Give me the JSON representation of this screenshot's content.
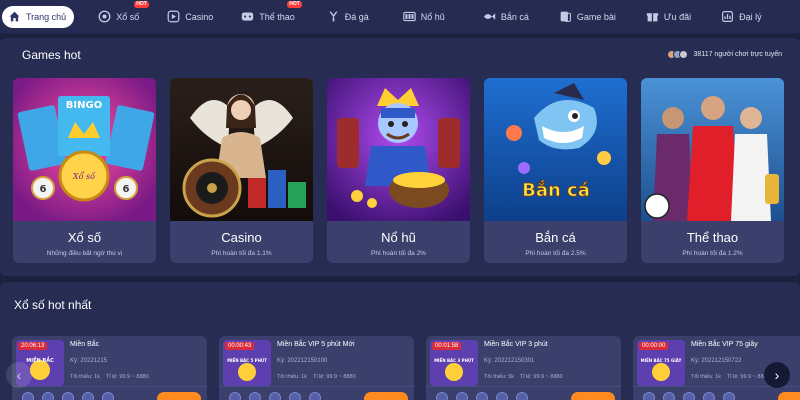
{
  "nav": {
    "items": [
      {
        "label": "Trang chủ",
        "icon": "home-icon",
        "active": true
      },
      {
        "label": "Xổ số",
        "icon": "lottery-icon",
        "hot": true
      },
      {
        "label": "Casino",
        "icon": "play-icon"
      },
      {
        "label": "Thể thao",
        "icon": "sports-icon",
        "hot": true
      },
      {
        "label": "Đá gà",
        "icon": "cockfight-icon"
      },
      {
        "label": "Nổ hũ",
        "icon": "slot-icon"
      },
      {
        "label": "Bắn cá",
        "icon": "fish-icon"
      },
      {
        "label": "Game bài",
        "icon": "cards-icon"
      },
      {
        "label": "Ưu đãi",
        "icon": "gift-icon"
      },
      {
        "label": "Đại lý",
        "icon": "agent-icon"
      }
    ],
    "hot_badge": "HOT"
  },
  "games_hot": {
    "title": "Games hot",
    "online_text": "38117 người chơi trực tuyến",
    "cards": [
      {
        "name": "Xổ số",
        "sub": "Những điều bất ngờ thú vị",
        "art_text": "Xổ số"
      },
      {
        "name": "Casino",
        "sub": "Phí hoàn tối đa 1.1%"
      },
      {
        "name": "Nổ hũ",
        "sub": "Phí hoàn tối đa 2%"
      },
      {
        "name": "Bắn cá",
        "sub": "Phí hoàn tối đa 2.5%",
        "art_text": "Bắn cá"
      },
      {
        "name": "Thể thao",
        "sub": "Phí hoàn tối đa 1.2%"
      }
    ]
  },
  "lottery_hot": {
    "title": "Xổ số hot nhất",
    "cards": [
      {
        "timer": "20:06:13",
        "name": "Miền Bắc",
        "code": "Kỳ: 20221215",
        "min": "Tối thiểu: 1k",
        "rate": "Tỉ lệ: 99.9 ~ 8880",
        "thumb": "MIỀN BẮC"
      },
      {
        "timer": "00:00:43",
        "name": "Miền Bắc VIP 5 phút Mới",
        "code": "Kỳ: 202212150100",
        "min": "Tối thiểu: 1k",
        "rate": "Tỉ lệ: 99.9 ~ 8880",
        "thumb": "MIỀN BẮC 5 PHÚT"
      },
      {
        "timer": "00:01:58",
        "name": "Miền Bắc VIP 3 phút",
        "code": "Kỳ: 202212150301",
        "min": "Tối thiểu: 5k",
        "rate": "Tỉ lệ: 99.9 ~ 8880",
        "thumb": "MIỀN BẮC 3 PHÚT"
      },
      {
        "timer": "00:00:00",
        "name": "Miền Bắc VIP 75 giây",
        "code": "Kỳ: 202212150722",
        "min": "Tối thiểu: 1k",
        "rate": "Tỉ lệ: 99.9 ~ 8880",
        "thumb": "MIỀN BẮC 75 GIÂY"
      }
    ]
  },
  "colors": {
    "background": "#1c2140",
    "panel": "#262c52",
    "card": "#3a3f6b",
    "timer": "#d92b3a",
    "bet_button": "#ff8a1f",
    "hot_badge": "#ff3b3b"
  }
}
